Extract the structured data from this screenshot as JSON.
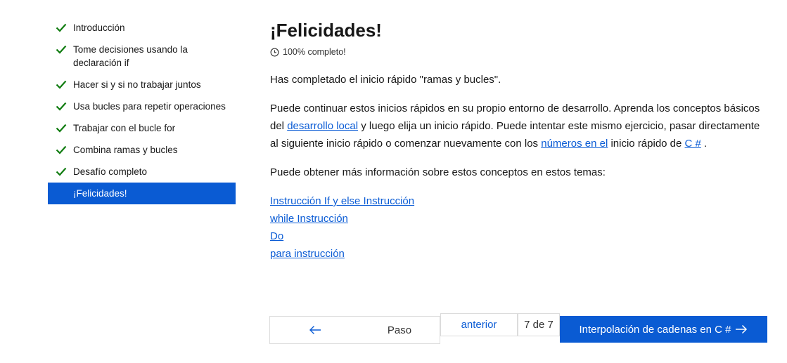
{
  "sidebar": {
    "items": [
      {
        "label": "Introducción",
        "done": true
      },
      {
        "label": "Tome decisiones usando la declaración if",
        "done": true
      },
      {
        "label": "Hacer si y si no trabajar juntos",
        "done": true
      },
      {
        "label": "Usa bucles para repetir operaciones",
        "done": true
      },
      {
        "label": "Trabajar con el bucle for",
        "done": true
      },
      {
        "label": "Combina ramas y bucles",
        "done": true
      },
      {
        "label": "Desafío completo",
        "done": true
      },
      {
        "label": "¡Felicidades!",
        "done": false,
        "active": true
      }
    ]
  },
  "main": {
    "title": "¡Felicidades!",
    "progress": "100% completo!",
    "p1": "Has completado el inicio rápido \"ramas y bucles\".",
    "p2": {
      "t1": "Puede continuar estos inicios rápidos en su propio entorno de desarrollo. Aprenda los conceptos básicos del ",
      "link1": "desarrollo local",
      "t2": " y luego elija un inicio rápido. Puede intentar este mismo ejercicio, pasar directamente al siguiente inicio rápido o comenzar nuevamente con los ",
      "link2": "números en el",
      "t3": " inicio rápido de ",
      "link3": "C #",
      "t4": " ."
    },
    "p3": "Puede obtener más información sobre estos conceptos en estos temas:",
    "links": [
      "Instrucción If y else Instrucción ",
      "while Instrucción ",
      "Do ",
      "para instrucción"
    ]
  },
  "pager": {
    "step_label": "Paso",
    "anterior": "anterior",
    "count": "7 de 7",
    "next_label": "Interpolación de cadenas en C #"
  },
  "colors": {
    "accent": "#0a5bd3",
    "check": "#107c10",
    "link": "#0b5cd5"
  }
}
